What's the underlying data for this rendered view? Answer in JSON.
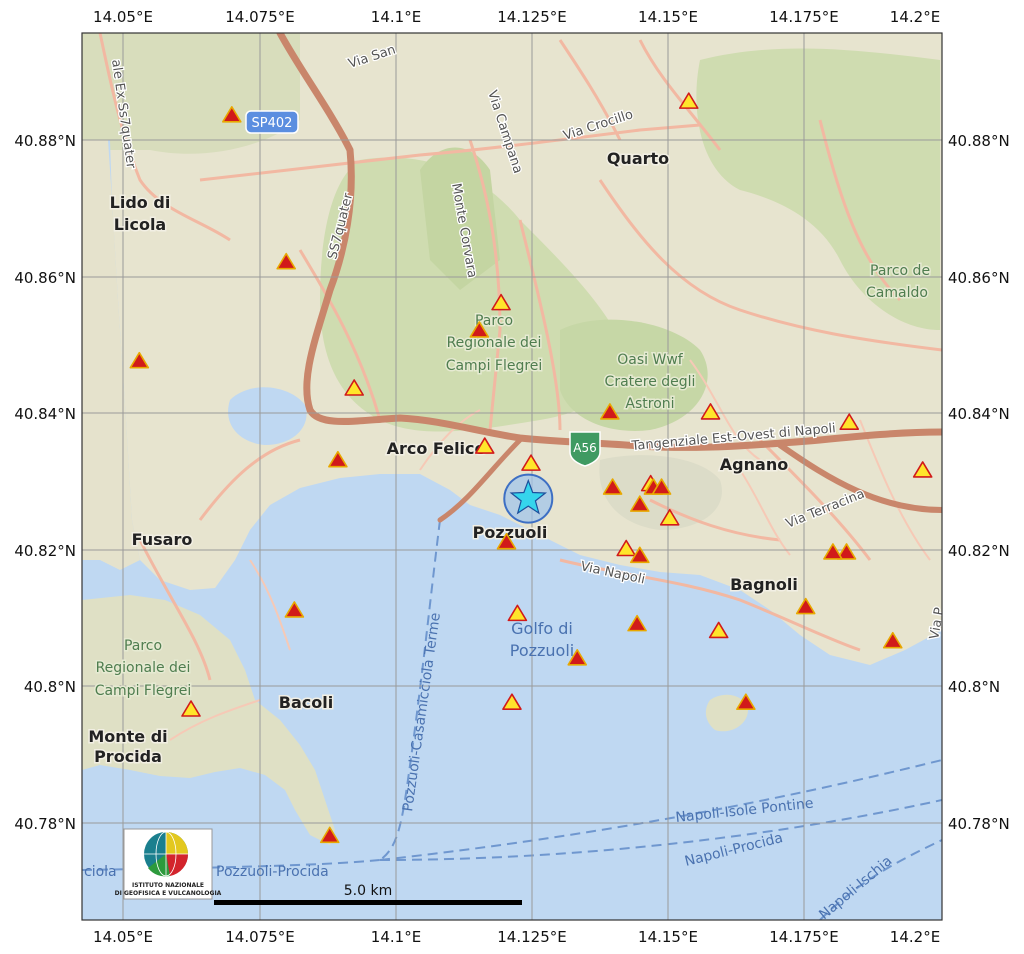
{
  "map": {
    "lon_ticks": [
      "14.05°E",
      "14.075°E",
      "14.1°E",
      "14.125°E",
      "14.15°E",
      "14.175°E",
      "14.2°E"
    ],
    "lat_ticks": [
      "40.88°N",
      "40.86°N",
      "40.84°N",
      "40.82°N",
      "40.8°N",
      "40.78°N"
    ],
    "places": {
      "lido_di_licola": [
        "Lido di",
        "Licola"
      ],
      "quarto": "Quarto",
      "arco_felice": "Arco Felice",
      "pozzuoli": "Pozzuoli",
      "agnano": "Agnano",
      "fusaro": "Fusaro",
      "bagnoli": "Bagnoli",
      "bacoli": "Bacoli",
      "monte_di_procida": [
        "Monte di",
        "Procida"
      ]
    },
    "parks": {
      "parco_campi_flegrei_north": [
        "Parco",
        "Regionale dei",
        "Campi Flegrei"
      ],
      "parco_campi_flegrei_west": [
        "Parco",
        "Regionale dei",
        "Campi Flegrei"
      ],
      "oasi_wwf": [
        "Oasi Wwf",
        "Cratere degli",
        "Astroni"
      ],
      "parco_camaldoli": [
        "Parco de",
        "Camaldo"
      ]
    },
    "roads": {
      "via_san": "Via San",
      "via_ex_ss7quater": "ale Ex Ss7quater",
      "sp402": "SP402",
      "via_campana": "Via Campana",
      "via_crocillo": "Via Crocillo",
      "monte_corvara": "Monte Corvara",
      "ss7quater": "SS7quater",
      "a56": "A56",
      "tangenziale": "Tangenziale Est-Ovest di Napoli",
      "via_terracina": "Via Terracina",
      "via_napoli": "Via Napoli",
      "via_p": "Via P"
    },
    "water": {
      "golfo": [
        "Golfo di",
        "Pozzuoli"
      ]
    },
    "ferries": {
      "pozzuoli_casamicciola": "Pozzuoli-Casamicciola Terme",
      "pozzuoli_procida": "Pozzuoli-Procida",
      "napoli_isole_pontine": "Napoli-Isole Pontine",
      "napoli_procida": "Napoli-Procida",
      "napoli_ischia": "Napoli-Ischia",
      "ciola": "ciola"
    },
    "scale_label": "5.0 km",
    "logo_text": [
      "ISTITUTO NAZIONALE",
      "DI GEOFISICA E VULCANOLOGIA"
    ],
    "epicenter": {
      "lon": 14.1245,
      "lat": 40.8275,
      "symbol": "cyan-star-icon"
    },
    "stations": [
      {
        "lon": 14.07,
        "lat": 40.8835,
        "type": "filled"
      },
      {
        "lon": 14.154,
        "lat": 40.8855,
        "type": "open"
      },
      {
        "lon": 14.08,
        "lat": 40.862,
        "type": "filled"
      },
      {
        "lon": 14.1195,
        "lat": 40.856,
        "type": "open"
      },
      {
        "lon": 14.1155,
        "lat": 40.852,
        "type": "filled"
      },
      {
        "lon": 14.053,
        "lat": 40.8475,
        "type": "filled"
      },
      {
        "lon": 14.0925,
        "lat": 40.8435,
        "type": "open"
      },
      {
        "lon": 14.1395,
        "lat": 40.84,
        "type": "filled"
      },
      {
        "lon": 14.158,
        "lat": 40.84,
        "type": "open"
      },
      {
        "lon": 14.1835,
        "lat": 40.8385,
        "type": "open"
      },
      {
        "lon": 14.0895,
        "lat": 40.833,
        "type": "filled"
      },
      {
        "lon": 14.1165,
        "lat": 40.835,
        "type": "open"
      },
      {
        "lon": 14.125,
        "lat": 40.8325,
        "type": "open"
      },
      {
        "lon": 14.197,
        "lat": 40.8315,
        "type": "open"
      },
      {
        "lon": 14.14,
        "lat": 40.829,
        "type": "filled"
      },
      {
        "lon": 14.147,
        "lat": 40.8295,
        "type": "open"
      },
      {
        "lon": 14.1475,
        "lat": 40.829,
        "type": "filled"
      },
      {
        "lon": 14.149,
        "lat": 40.829,
        "type": "filled"
      },
      {
        "lon": 14.145,
        "lat": 40.8265,
        "type": "filled"
      },
      {
        "lon": 14.1505,
        "lat": 40.8245,
        "type": "open"
      },
      {
        "lon": 14.1205,
        "lat": 40.821,
        "type": "filled"
      },
      {
        "lon": 14.1425,
        "lat": 40.82,
        "type": "open"
      },
      {
        "lon": 14.145,
        "lat": 40.819,
        "type": "filled"
      },
      {
        "lon": 14.183,
        "lat": 40.8195,
        "type": "filled"
      },
      {
        "lon": 14.1805,
        "lat": 40.8195,
        "type": "filled"
      },
      {
        "lon": 14.0815,
        "lat": 40.811,
        "type": "filled"
      },
      {
        "lon": 14.1755,
        "lat": 40.8115,
        "type": "filled"
      },
      {
        "lon": 14.1225,
        "lat": 40.8105,
        "type": "open"
      },
      {
        "lon": 14.1445,
        "lat": 40.809,
        "type": "filled"
      },
      {
        "lon": 14.1595,
        "lat": 40.808,
        "type": "open"
      },
      {
        "lon": 14.1915,
        "lat": 40.8065,
        "type": "filled"
      },
      {
        "lon": 14.1335,
        "lat": 40.804,
        "type": "filled"
      },
      {
        "lon": 14.0625,
        "lat": 40.7965,
        "type": "open"
      },
      {
        "lon": 14.1215,
        "lat": 40.7975,
        "type": "open"
      },
      {
        "lon": 14.1645,
        "lat": 40.7975,
        "type": "filled"
      },
      {
        "lon": 14.088,
        "lat": 40.778,
        "type": "filled"
      }
    ],
    "colors": {
      "water": "#bfd8f2",
      "land": "#e7e4cf",
      "green": "#cfdcb0",
      "road_major": "#d99276",
      "road_minor": "#f2b8a2",
      "grid": "#9a9a9a",
      "triangle_fill": "#d11a1a",
      "triangle_open_fill": "#ffe52b",
      "triangle_stroke": "#e8a800",
      "star": "#35d5ec"
    }
  }
}
